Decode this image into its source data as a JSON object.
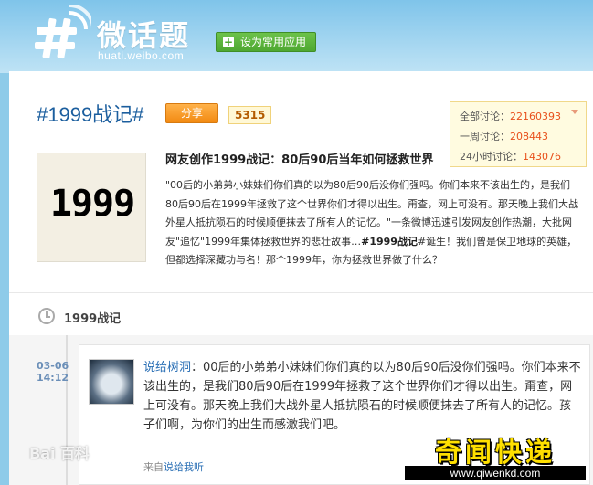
{
  "header": {
    "logo_title": "微话题",
    "logo_subtitle": "huati.weibo.com",
    "app_button_label": "设为常用应用",
    "colors": {
      "sky": "#8ecbe9",
      "accent_green": "#4ea831"
    }
  },
  "topic": {
    "title": "#1999战记#",
    "share_label": "分享",
    "share_count": "5315",
    "thumbnail_text": "1999",
    "headline": "网友创作1999战记：80后90后当年如何拯救世界",
    "description_1": "\"00后的小弟弟小妹妹们你们真的以为80后90后没你们强吗。你们本来不该出生的，是我们80后90后在1999年拯救了这个世界你们才得以出生。甭查，网上可没有。那天晚上我们大战外星人抵抗陨石的时候顺便抹去了所有人的记忆。\"一条微博迅速引发网友创作热潮，大批网友\"追忆\"1999年集体拯救世界的悲壮故事…",
    "description_tag": "#1999战记",
    "description_2": "#诞生！我们曾是保卫地球的英雄，但都选择深藏功与名！那个1999年，你为拯救世界做了什么？"
  },
  "stats": {
    "total_label": "全部讨论：",
    "total_value": "22160393",
    "week_label": "一周讨论：",
    "week_value": "208443",
    "day_label": "24小时讨论：",
    "day_value": "143076"
  },
  "feed": {
    "section_title": "1999战记",
    "post": {
      "date": "03-06",
      "time": "14:12",
      "user": "说给树洞",
      "text": "：00后的小弟弟小妹妹们你们真的以为80后90后没你们强吗。你们本来不该出生的，是我们80后90后在1999年拯救了这个世界你们才得以出生。甭查，网上可没有。那天晚上我们大战外星人抵抗陨石的时候顺便抹去了所有人的记忆。孩子们啊，为你们的出生而感激我们吧。",
      "from_label": "来自",
      "from_source": "说给我听"
    }
  },
  "overlays": {
    "watermark": "Bai 百科",
    "brand_name": "奇闻快递",
    "brand_url": "www.qiwenkd.com"
  }
}
